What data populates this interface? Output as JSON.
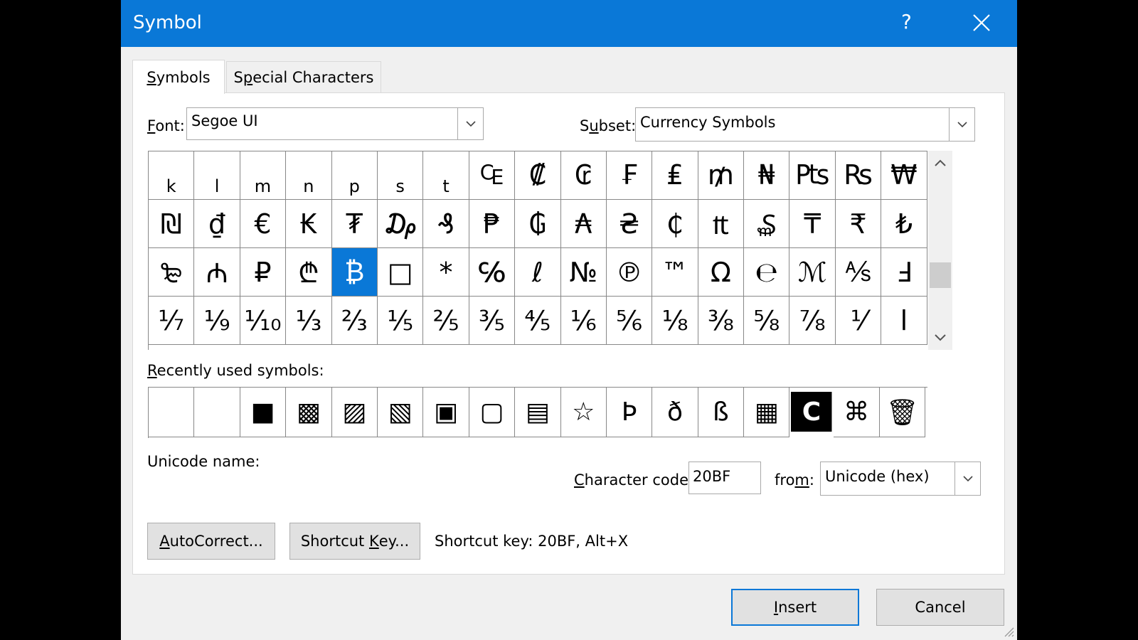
{
  "window": {
    "title": "Symbol",
    "help_glyph": "?",
    "close_icon": "close-icon"
  },
  "tabs": [
    {
      "pre": "",
      "key": "S",
      "post": "ymbols",
      "active": true
    },
    {
      "pre": "S",
      "key": "p",
      "post": "ecial Characters",
      "active": false
    }
  ],
  "font_field": {
    "label_key": "F",
    "label_rest": "ont:",
    "value": "Segoe UI"
  },
  "subset_field": {
    "label_pre": "S",
    "label_key": "u",
    "label_rest": "bset:",
    "value": "Currency Symbols"
  },
  "symbol_grid": {
    "rows": [
      [
        "k",
        "l",
        "m",
        "n",
        "p",
        "s",
        "t",
        "₠",
        "₡",
        "₢",
        "₣",
        "₤",
        "₥",
        "₦",
        "₧",
        "₨",
        "₩"
      ],
      [
        "₪",
        "₫",
        "€",
        "₭",
        "₮",
        "₯",
        "₰",
        "₱",
        "₲",
        "₳",
        "₴",
        "₵",
        "₶",
        "₷",
        "₸",
        "₹",
        "₺"
      ],
      [
        "₻",
        "₼",
        "₽",
        "₾",
        "₿",
        "□",
        "*",
        "℅",
        "ℓ",
        "№",
        "℗",
        "™",
        "Ω",
        "℮",
        "ℳ",
        "⅍",
        "Ⅎ"
      ],
      [
        "⅐",
        "⅑",
        "⅒",
        "⅓",
        "⅔",
        "⅕",
        "⅖",
        "⅗",
        "⅘",
        "⅙",
        "⅚",
        "⅛",
        "⅜",
        "⅝",
        "⅞",
        "⅟",
        "ⅼ"
      ]
    ],
    "selected": {
      "row": 2,
      "col": 4
    }
  },
  "recent": {
    "label_key": "R",
    "label_rest": "ecently used symbols:",
    "symbols": [
      "",
      "",
      "■",
      "▩",
      "▨",
      "▧",
      "▣",
      "▢",
      "▤",
      "☆",
      "Þ",
      "ð",
      "ß",
      "▦",
      "C",
      "⌘",
      "🗑"
    ]
  },
  "unicode_name_label": "Unicode name:",
  "character_code": {
    "label_key": "C",
    "label_rest": "haracter code:",
    "value": "20BF"
  },
  "from_field": {
    "label_pre": "fro",
    "label_key": "m",
    "label_rest": ":",
    "value": "Unicode (hex)"
  },
  "buttons": {
    "autocorrect": {
      "key": "A",
      "rest": "utoCorrect..."
    },
    "shortcut_key": {
      "pre": "Shortcut ",
      "key": "K",
      "rest": "ey..."
    },
    "insert": {
      "key": "I",
      "rest": "nsert"
    },
    "cancel": "Cancel"
  },
  "shortcut_key_info": "Shortcut key: 20BF, Alt+X",
  "colors": {
    "accent": "#0a78d7",
    "dialog_bg": "#f0f0f0"
  }
}
